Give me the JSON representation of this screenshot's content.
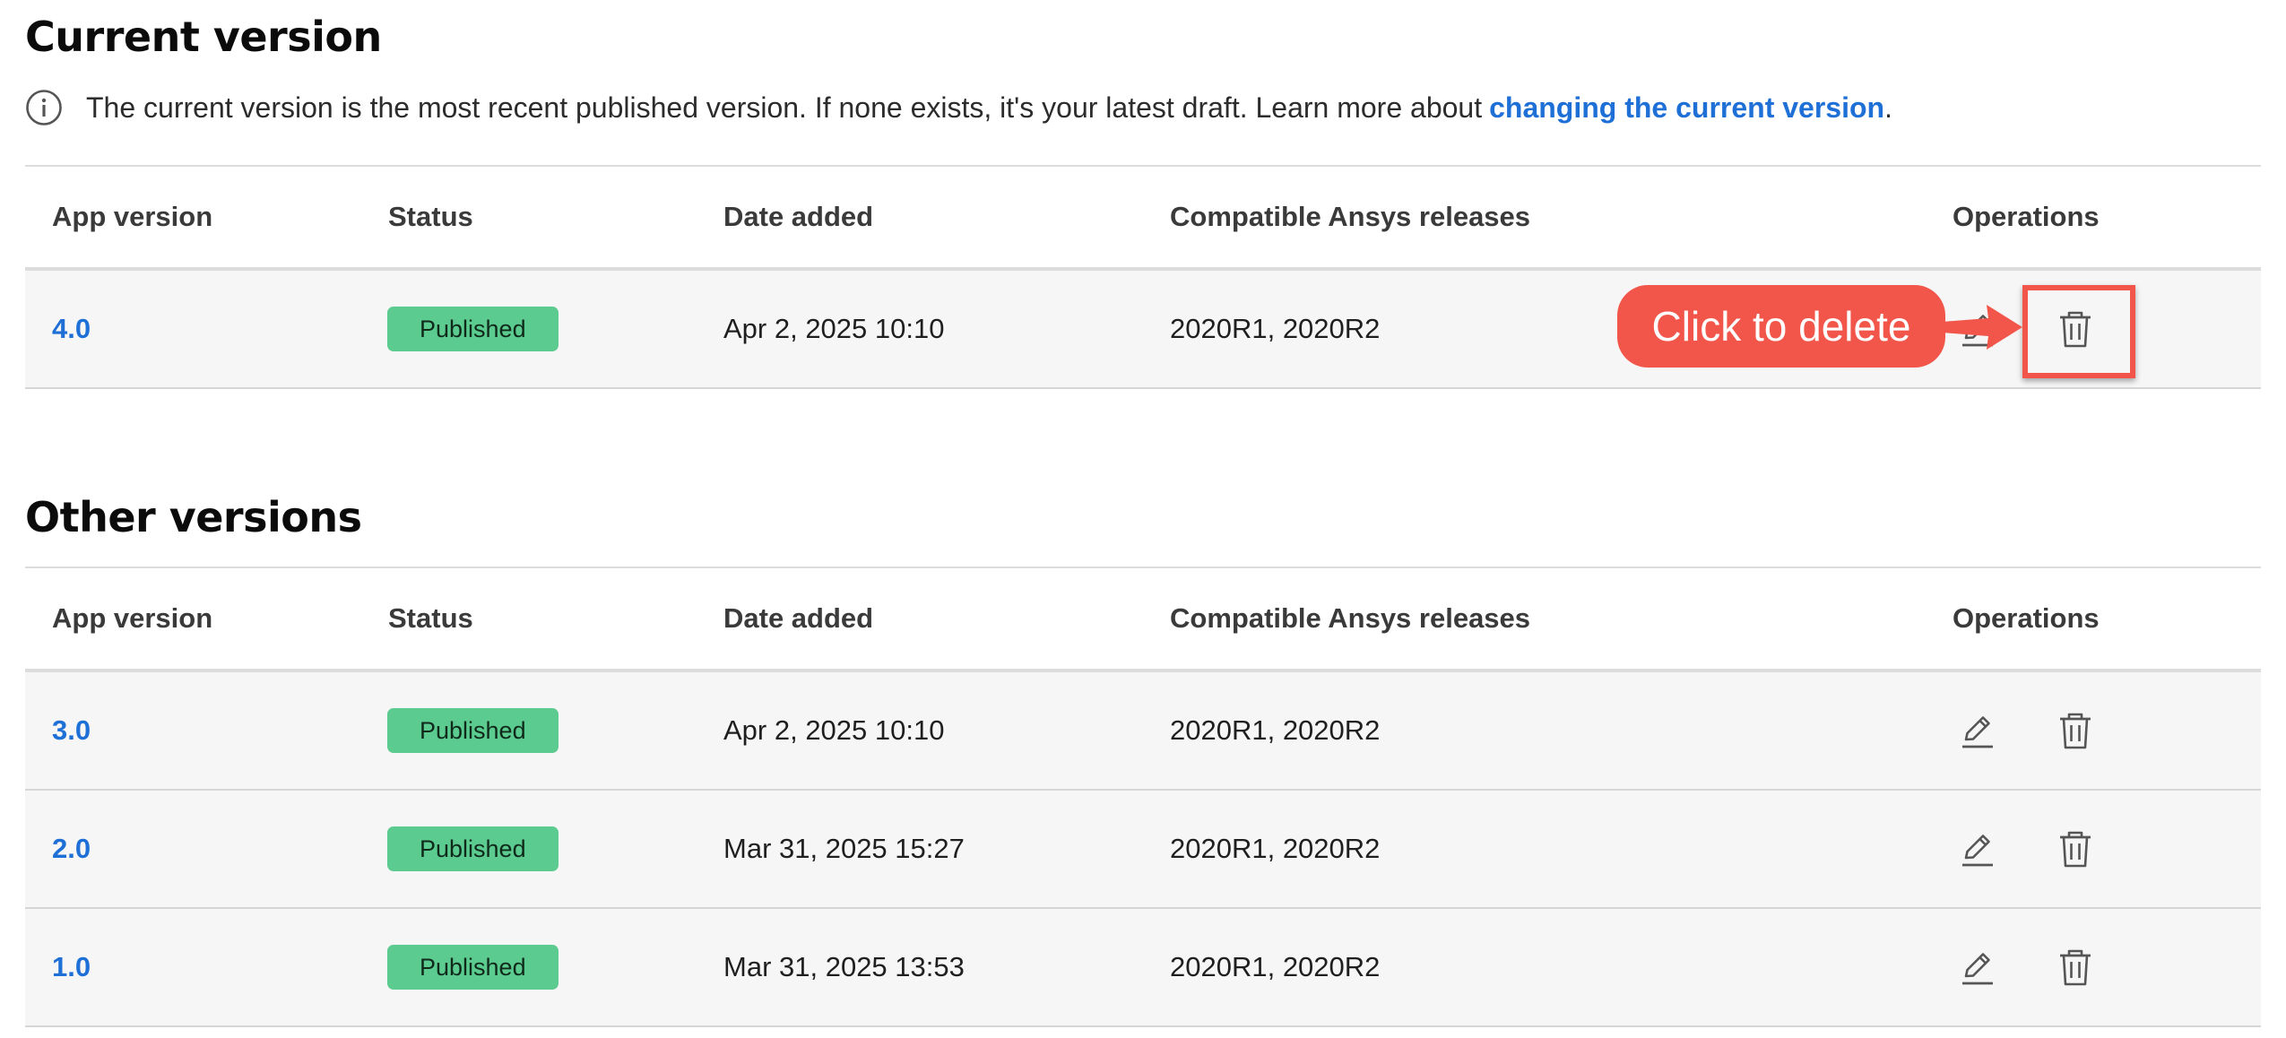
{
  "current": {
    "title": "Current version",
    "info_text": "The current version is the most recent published version. If none exists, it's your latest draft. Learn more about",
    "info_link": "changing the current version",
    "info_end": ".",
    "columns": [
      "App version",
      "Status",
      "Date added",
      "Compatible Ansys releases",
      "Operations"
    ],
    "rows": [
      {
        "version": "4.0",
        "status": "Published",
        "date": "Apr 2, 2025 10:10",
        "releases": "2020R1, 2020R2"
      }
    ]
  },
  "other": {
    "title": "Other versions",
    "columns": [
      "App version",
      "Status",
      "Date added",
      "Compatible Ansys releases",
      "Operations"
    ],
    "rows": [
      {
        "version": "3.0",
        "status": "Published",
        "date": "Apr 2, 2025 10:10",
        "releases": "2020R1, 2020R2"
      },
      {
        "version": "2.0",
        "status": "Published",
        "date": "Mar 31, 2025 15:27",
        "releases": "2020R1, 2020R2"
      },
      {
        "version": "1.0",
        "status": "Published",
        "date": "Mar 31, 2025 13:53",
        "releases": "2020R1, 2020R2"
      }
    ]
  },
  "annotation": {
    "callout_text": "Click to delete"
  },
  "icons": {
    "info": "info-icon",
    "edit": "pencil-icon",
    "delete": "trash-icon"
  },
  "colors": {
    "link": "#1e6fd6",
    "badge": "#5ccb8f",
    "callout": "#f2564a",
    "row_bg": "#f6f6f6"
  }
}
